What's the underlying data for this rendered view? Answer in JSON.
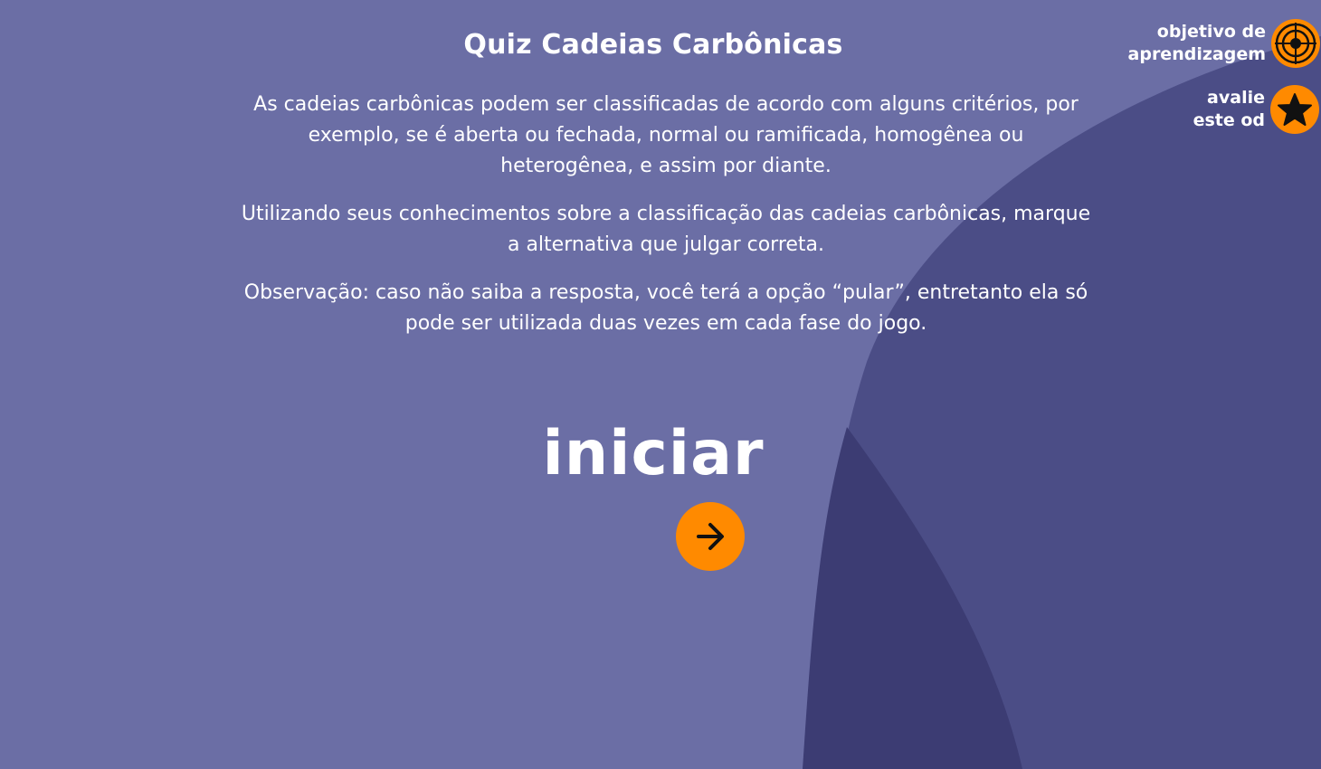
{
  "quiz": {
    "title": "Quiz Cadeias Carbônicas",
    "paragraphs": [
      "As cadeias carbônicas podem ser classificadas de acordo com alguns critérios, por exemplo, se é aberta ou fechada, normal ou ramificada, homogênea ou heterogênea, e assim por diante.",
      "Utilizando seus conhecimentos sobre a classificação das cadeias carbônicas, marque a alternativa que julgar correta.",
      "Observação: caso não saiba a resposta, você terá a opção “pular”, entretanto ela só pode ser utilizada duas vezes em cada fase do jogo."
    ],
    "start_label": "iniciar"
  },
  "side_menu": {
    "objective_line1": "objetivo de",
    "objective_line2": "aprendizagem",
    "rate_line1": "avalie",
    "rate_line2": "este od"
  },
  "icons": {
    "start": "arrow-right-icon",
    "objective": "target-icon",
    "rate": "star-icon"
  },
  "colors": {
    "background": "#6b6ea5",
    "shape_mid": "#4b4d86",
    "shape_dark": "#3c3c73",
    "accent": "#ff8a00",
    "text": "#ffffff"
  }
}
